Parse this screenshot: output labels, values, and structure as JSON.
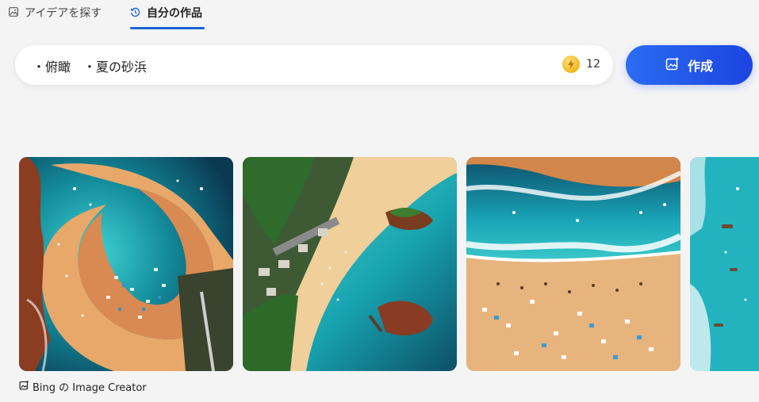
{
  "tabs": [
    {
      "label": "アイデアを探す",
      "icon": "image-icon",
      "active": false
    },
    {
      "label": "自分の作品",
      "icon": "history-icon",
      "active": true
    }
  ],
  "prompt": {
    "text": "・俯瞰　・夏の砂浜"
  },
  "boosts": {
    "count": "12",
    "icon": "boost-coin-icon"
  },
  "create_button": {
    "label": "作成",
    "icon": "image-sparkle-icon"
  },
  "gallery": {
    "images": [
      {
        "name": "beach-image-1"
      },
      {
        "name": "beach-image-2"
      },
      {
        "name": "beach-image-3"
      },
      {
        "name": "beach-image-4"
      }
    ]
  },
  "caption": {
    "text": "Bing の Image Creator",
    "icon": "image-sparkle-icon"
  },
  "colors": {
    "accent": "#1a64d6",
    "button_start": "#2b6df2",
    "button_end": "#1c44e0",
    "background": "#f4f4f5"
  }
}
